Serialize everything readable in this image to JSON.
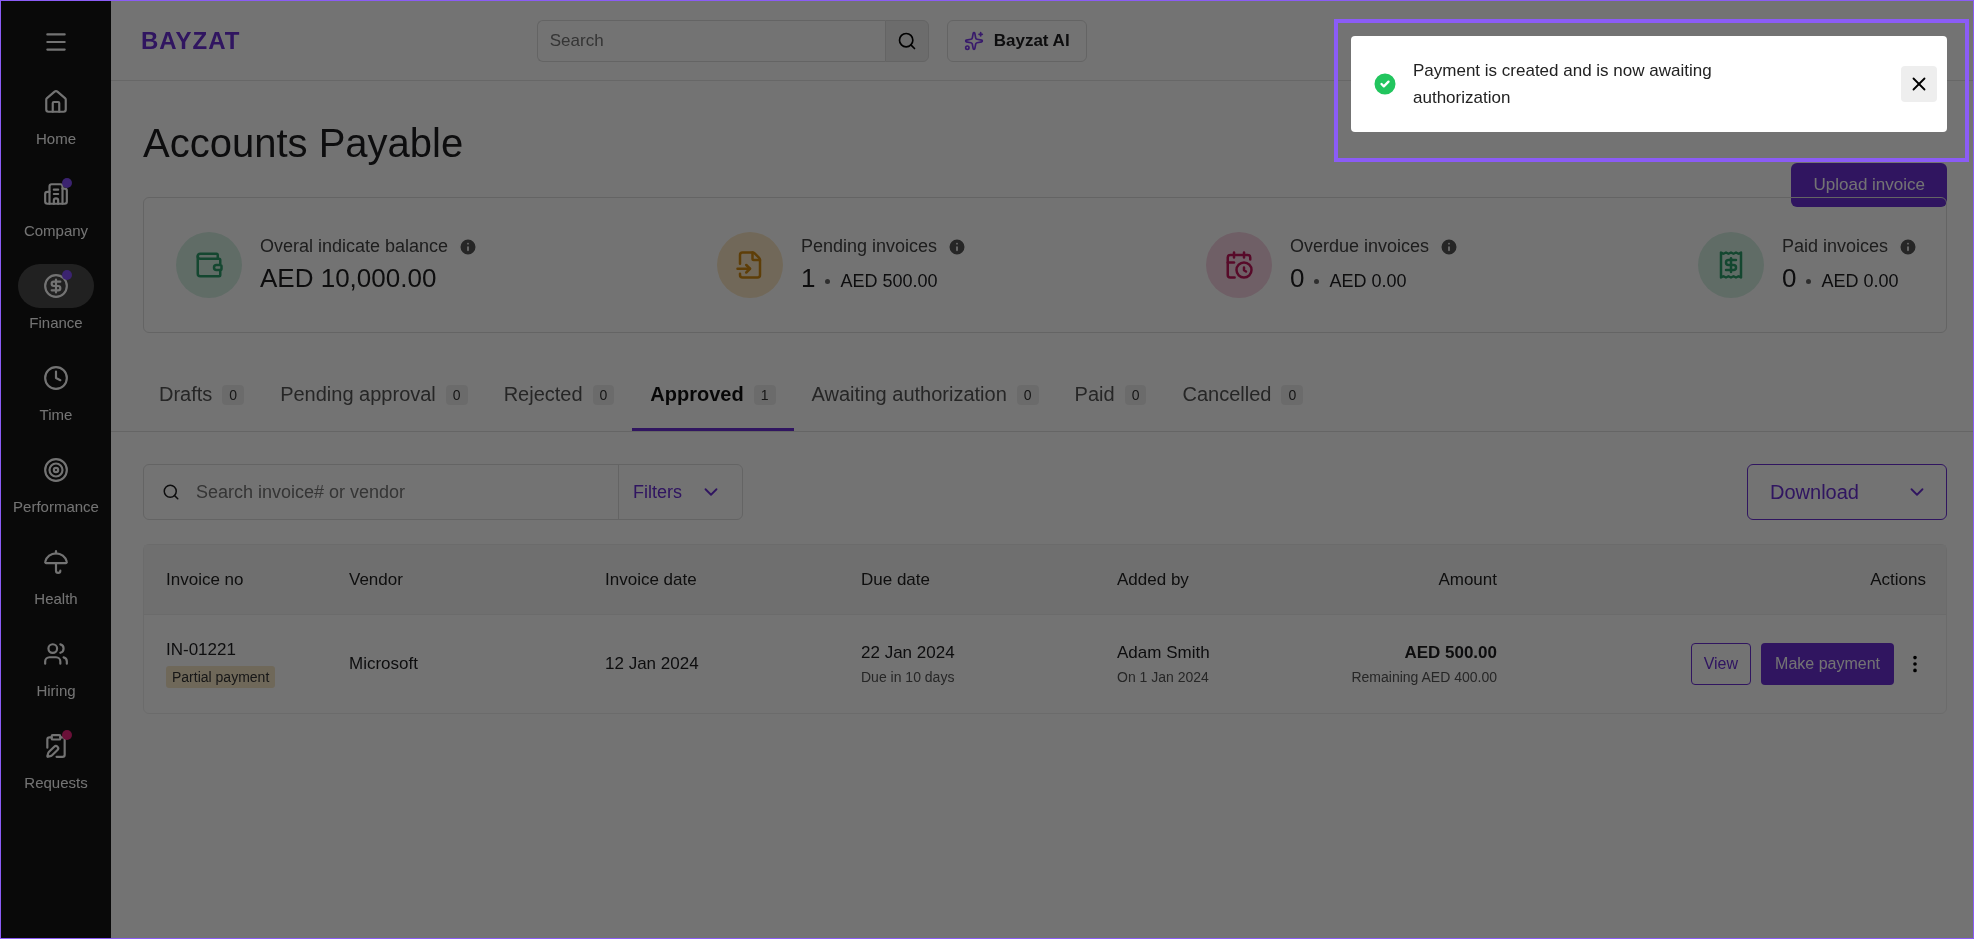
{
  "sidebar": {
    "items": [
      {
        "label": "Home",
        "kind": "home",
        "selected": false
      },
      {
        "label": "Company",
        "kind": "company",
        "selected": false,
        "color": "#3b2370"
      },
      {
        "label": "Finance",
        "kind": "finance",
        "selected": true,
        "color": "#3b2370"
      },
      {
        "label": "Time",
        "kind": "time",
        "selected": false
      },
      {
        "label": "Performance",
        "kind": "performance",
        "selected": false
      },
      {
        "label": "Health",
        "kind": "health",
        "selected": false
      },
      {
        "label": "Hiring",
        "kind": "hiring",
        "selected": false
      },
      {
        "label": "Requests",
        "kind": "requests",
        "selected": false,
        "color": "#6a1038"
      }
    ]
  },
  "topbar": {
    "logo": "BAYZAT",
    "search": {
      "placeholder": "Search"
    },
    "ai_button": "Bayzat AI"
  },
  "page": {
    "title": "Accounts Payable",
    "upload_button": "Upload invoice"
  },
  "stats": [
    {
      "kind": "balance",
      "label": "Overal indicate balance",
      "value": "AED 10,000.00"
    },
    {
      "kind": "pending",
      "label": "Pending invoices",
      "count": "1",
      "amount": "AED 500.00"
    },
    {
      "kind": "overdue",
      "label": "Overdue invoices",
      "count": "0",
      "amount": "AED 0.00"
    },
    {
      "kind": "paid",
      "label": "Paid invoices",
      "count": "0",
      "amount": "AED 0.00"
    }
  ],
  "tabs": [
    {
      "label": "Drafts",
      "count": "0",
      "selected": false
    },
    {
      "label": "Pending approval",
      "count": "0",
      "selected": false
    },
    {
      "label": "Rejected",
      "count": "0",
      "selected": false
    },
    {
      "label": "Approved",
      "count": "1",
      "selected": true
    },
    {
      "label": "Awaiting authorization",
      "count": "0",
      "selected": false
    },
    {
      "label": "Paid",
      "count": "0",
      "selected": false
    },
    {
      "label": "Cancelled",
      "count": "0",
      "selected": false
    }
  ],
  "filters": {
    "search": {
      "placeholder": "Search invoice# or vendor"
    },
    "filters_button": "Filters",
    "download_button": "Download"
  },
  "table": {
    "columns": [
      "Invoice no",
      "Vendor",
      "Invoice date",
      "Due date",
      "Added by",
      "Amount",
      "Actions"
    ],
    "rows": [
      {
        "invoice_no": "IN-01221",
        "tag": "Partial payment",
        "vendor": "Microsoft",
        "invoice_date": "12 Jan 2024",
        "due_date": "22 Jan 2024",
        "due_note": "Due in 10 days",
        "added_by": "Adam Smith",
        "added_on": "On 1 Jan 2024",
        "amount": "AED 500.00",
        "remaining": "Remaining AED 400.00",
        "actions": [
          "View",
          "Make payment"
        ]
      }
    ]
  },
  "toast": {
    "message": "Payment is created and is now awaiting authorization"
  }
}
